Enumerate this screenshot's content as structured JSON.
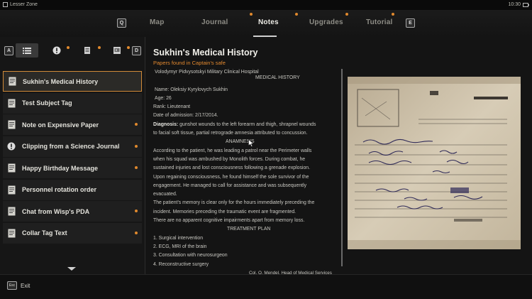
{
  "topbar": {
    "location": "Lesser Zone",
    "time": "10:30"
  },
  "nav": {
    "left_key": "Q",
    "right_key": "E",
    "tabs": [
      {
        "label": "Map"
      },
      {
        "label": "Journal"
      },
      {
        "label": "Notes"
      },
      {
        "label": "Upgrades"
      },
      {
        "label": "Tutorial"
      }
    ]
  },
  "filters": {
    "left_key": "A",
    "right_key": "D"
  },
  "notes": [
    {
      "label": "Sukhin's Medical History",
      "icon": "note-icon",
      "new": false
    },
    {
      "label": "Test Subject Tag",
      "icon": "note-icon",
      "new": false
    },
    {
      "label": "Note on Expensive Paper",
      "icon": "note-icon",
      "new": true
    },
    {
      "label": "Clipping from a Science Journal",
      "icon": "exclamation-icon",
      "new": true
    },
    {
      "label": "Happy Birthday Message",
      "icon": "note-icon",
      "new": true
    },
    {
      "label": "Personnel rotation order",
      "icon": "note-icon",
      "new": false
    },
    {
      "label": "Chat from Wisp's PDA",
      "icon": "note-icon",
      "new": true
    },
    {
      "label": "Collar Tag Text",
      "icon": "note-icon",
      "new": true
    }
  ],
  "detail": {
    "title": "Sukhin's Medical History",
    "subtitle": "Papers found in Captain's safe",
    "doc": {
      "header1": "Volodymyr Pidvysotskyi Military Clinical Hospital",
      "header2": "MEDICAL HISTORY",
      "name": "Name: Oleksiy Kyrylovych Sukhin",
      "age": "Age: 26",
      "rank": "Rank: Lieutenant",
      "admission": "Date of admission: 2/17/2014.",
      "diagnosis_label": "Diagnosis:",
      "diagnosis_1": " gunshot wounds to the left forearm and thigh, shrapnel wounds",
      "diagnosis_2": "to facial soft tissue, partial retrograde amnesia attributed to concussion.",
      "anamnesis": "ANAMNESIS",
      "p1": " According to the patient, he was leading a patrol near the Perimeter walls",
      "p2": "when his squad was ambushed by Monolith forces. During combat, he",
      "p3": "sustained injuries and lost consciousness following a grenade explosion.",
      "p4": "Upon regaining consciousness, he found himself the sole survivor of the",
      "p5": "engagement. He managed to call for assistance and was subsequently",
      "p6": "evacuated.",
      "p7": "The patient's memory is clear only for the hours immediately preceding the",
      "p8": "incident. Memories preceding the traumatic event are fragmented.",
      "p9": "There are no apparent cognitive impairments apart from memory loss.",
      "plan": "TREATMENT PLAN",
      "t1": " 1. Surgical intervention",
      "t2": "2. ECG, MRI of the brain",
      "t3": "3. Consultation with neurosurgeon",
      "t4": "4. Reconstructive surgery",
      "signature": "Col. O. Mendel, Head of Medical Services"
    }
  },
  "footer": {
    "exit_key": "Esc",
    "exit_label": "Exit"
  },
  "colors": {
    "accent": "#e0892d",
    "background": "#0e0e0e"
  }
}
